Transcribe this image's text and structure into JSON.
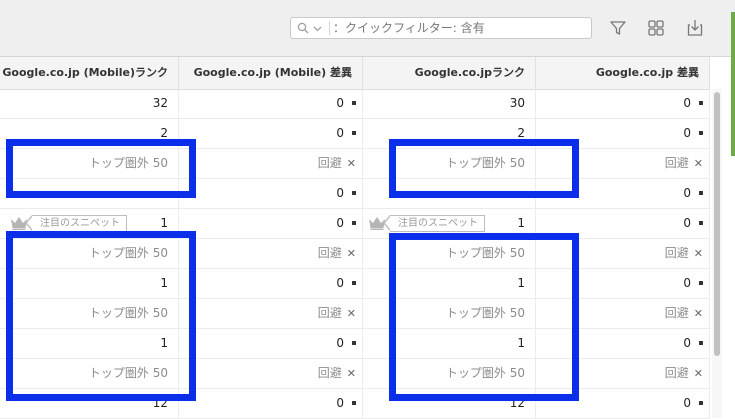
{
  "toolbar": {
    "filter_placeholder": "：クイックフィルター: 含有",
    "icons": [
      "search-icon",
      "chevron-down-icon",
      "filter-icon",
      "grid-icon",
      "export-icon"
    ]
  },
  "columns": [
    "Google.co.jp (Mobile)ランク",
    "Google.co.jp (Mobile) 差異",
    "Google.co.jpランク",
    "Google.co.jp 差異"
  ],
  "snippet_label": "注目のスニペット",
  "rows": [
    {
      "mobile_rank": "32",
      "mobile_diff": "0",
      "rank": "30",
      "diff": "0"
    },
    {
      "mobile_rank": "2",
      "mobile_diff": "0",
      "rank": "2",
      "diff": "0"
    },
    {
      "mobile_rank": "トップ圏外 50",
      "mobile_diff": "回避",
      "rank": "トップ圏外 50",
      "diff": "回避"
    },
    {
      "mobile_rank": "",
      "mobile_diff": "0",
      "rank": "",
      "diff": "0"
    },
    {
      "mobile_rank": "1",
      "mobile_diff": "0",
      "rank": "1",
      "diff": "0"
    },
    {
      "mobile_rank": "トップ圏外 50",
      "mobile_diff": "回避",
      "rank": "トップ圏外 50",
      "diff": "回避"
    },
    {
      "mobile_rank": "1",
      "mobile_diff": "0",
      "rank": "1",
      "diff": "0"
    },
    {
      "mobile_rank": "トップ圏外 50",
      "mobile_diff": "回避",
      "rank": "トップ圏外 50",
      "diff": "回避"
    },
    {
      "mobile_rank": "1",
      "mobile_diff": "0",
      "rank": "1",
      "diff": "0"
    },
    {
      "mobile_rank": "トップ圏外 50",
      "mobile_diff": "回避",
      "rank": "トップ圏外 50",
      "diff": "回避"
    },
    {
      "mobile_rank": "12",
      "mobile_diff": "0",
      "rank": "12",
      "diff": "0"
    }
  ],
  "colors": {
    "highlight_box": "#0a2eea",
    "accent_green": "#6cab45"
  }
}
